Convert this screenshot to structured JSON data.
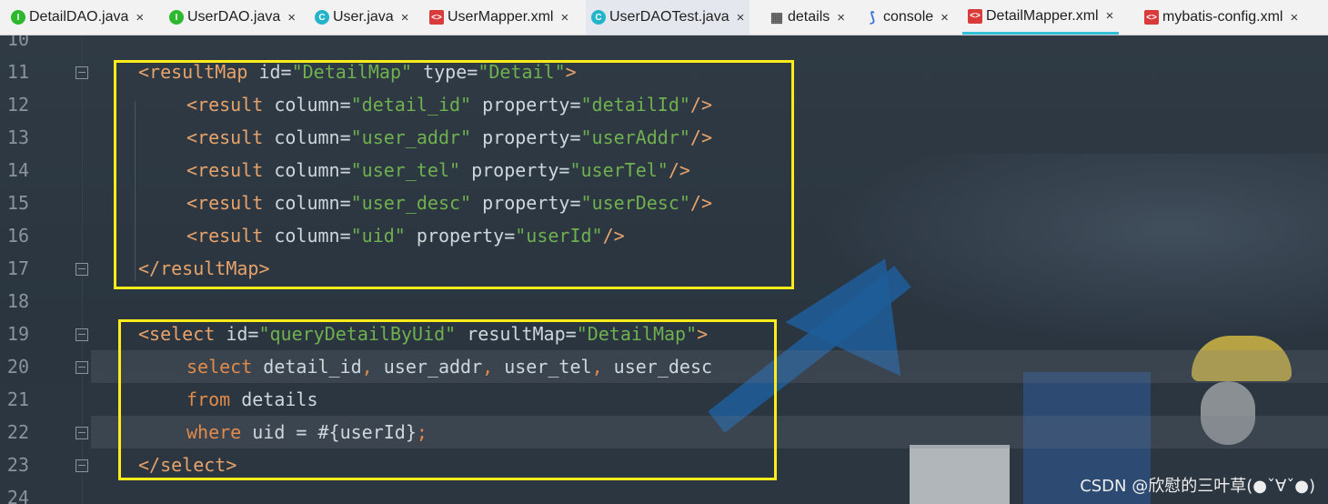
{
  "tabs": [
    {
      "label": "DetailDAO.java",
      "icon": "interface-icon",
      "icon_letter": "I",
      "icon_color": "#2eb82e",
      "active": false
    },
    {
      "label": "UserDAO.java",
      "icon": "interface-icon",
      "icon_letter": "I",
      "icon_color": "#2eb82e",
      "active": false
    },
    {
      "label": "User.java",
      "icon": "class-icon",
      "icon_letter": "C",
      "icon_color": "#22b5c9",
      "active": false
    },
    {
      "label": "UserMapper.xml",
      "icon": "xml-file-icon",
      "icon_letter": "<>",
      "icon_color": "#d93b3b",
      "active": false
    },
    {
      "label": "UserDAOTest.java",
      "icon": "test-class-icon",
      "icon_letter": "C",
      "icon_color": "#22b5c9",
      "active": true
    },
    {
      "label": "details",
      "icon": "table-icon",
      "icon_letter": "▦",
      "icon_color": "#555555",
      "active": false
    },
    {
      "label": "console",
      "icon": "console-icon",
      "icon_letter": "⟆",
      "icon_color": "#3b6fd9",
      "active": false
    },
    {
      "label": "DetailMapper.xml",
      "icon": "xml-file-icon",
      "icon_letter": "<>",
      "icon_color": "#d93b3b",
      "active": false,
      "selected": true
    },
    {
      "label": "mybatis-config.xml",
      "icon": "xml-file-icon",
      "icon_letter": "<>",
      "icon_color": "#d93b3b",
      "active": false
    }
  ],
  "close_glyph": "×",
  "lines": [
    {
      "num": "10",
      "tokens": []
    },
    {
      "num": "11",
      "tokens": [
        [
          "tag",
          "<resultMap "
        ],
        [
          "attr",
          "id"
        ],
        [
          "eq",
          "="
        ],
        [
          "str",
          "\"DetailMap\""
        ],
        [
          "attr",
          " type"
        ],
        [
          "eq",
          "="
        ],
        [
          "str",
          "\"Detail\""
        ],
        [
          "tag",
          ">"
        ]
      ]
    },
    {
      "num": "12",
      "tokens": [
        [
          "tag",
          "<result "
        ],
        [
          "attr",
          "column"
        ],
        [
          "eq",
          "="
        ],
        [
          "str",
          "\"detail_id\""
        ],
        [
          "attr",
          " property"
        ],
        [
          "eq",
          "="
        ],
        [
          "str",
          "\"detailId\""
        ],
        [
          "tag",
          "/>"
        ]
      ]
    },
    {
      "num": "13",
      "tokens": [
        [
          "tag",
          "<result "
        ],
        [
          "attr",
          "column"
        ],
        [
          "eq",
          "="
        ],
        [
          "str",
          "\"user_addr\""
        ],
        [
          "attr",
          " property"
        ],
        [
          "eq",
          "="
        ],
        [
          "str",
          "\"userAddr\""
        ],
        [
          "tag",
          "/>"
        ]
      ]
    },
    {
      "num": "14",
      "tokens": [
        [
          "tag",
          "<result "
        ],
        [
          "attr",
          "column"
        ],
        [
          "eq",
          "="
        ],
        [
          "str",
          "\"user_tel\""
        ],
        [
          "attr",
          " property"
        ],
        [
          "eq",
          "="
        ],
        [
          "str",
          "\"userTel\""
        ],
        [
          "tag",
          "/>"
        ]
      ]
    },
    {
      "num": "15",
      "tokens": [
        [
          "tag",
          "<result "
        ],
        [
          "attr",
          "column"
        ],
        [
          "eq",
          "="
        ],
        [
          "str",
          "\"user_desc\""
        ],
        [
          "attr",
          " property"
        ],
        [
          "eq",
          "="
        ],
        [
          "str",
          "\"userDesc\""
        ],
        [
          "tag",
          "/>"
        ]
      ]
    },
    {
      "num": "16",
      "tokens": [
        [
          "tag",
          "<result "
        ],
        [
          "attr",
          "column"
        ],
        [
          "eq",
          "="
        ],
        [
          "str",
          "\"uid\""
        ],
        [
          "attr",
          " property"
        ],
        [
          "eq",
          "="
        ],
        [
          "str",
          "\"userId\""
        ],
        [
          "tag",
          "/>"
        ]
      ]
    },
    {
      "num": "17",
      "tokens": [
        [
          "tag",
          "</resultMap>"
        ]
      ]
    },
    {
      "num": "18",
      "tokens": []
    },
    {
      "num": "19",
      "tokens": [
        [
          "tag",
          "<select "
        ],
        [
          "attr",
          "id"
        ],
        [
          "eq",
          "="
        ],
        [
          "str",
          "\"queryDetailByUid\""
        ],
        [
          "attr",
          " resultMap"
        ],
        [
          "eq",
          "="
        ],
        [
          "str",
          "\"DetailMap\""
        ],
        [
          "tag",
          ">"
        ]
      ]
    },
    {
      "num": "20",
      "tokens": [
        [
          "kw",
          "select"
        ],
        [
          "txt",
          " detail_id"
        ],
        [
          "punct",
          ","
        ],
        [
          "txt",
          " user_addr"
        ],
        [
          "punct",
          ","
        ],
        [
          "txt",
          " user_tel"
        ],
        [
          "punct",
          ","
        ],
        [
          "txt",
          " user_desc"
        ]
      ]
    },
    {
      "num": "21",
      "tokens": [
        [
          "kw",
          "from"
        ],
        [
          "txt",
          " details"
        ]
      ]
    },
    {
      "num": "22",
      "tokens": [
        [
          "kw",
          "where"
        ],
        [
          "txt",
          " uid = #{userId}"
        ],
        [
          "punct",
          ";"
        ]
      ]
    },
    {
      "num": "23",
      "tokens": [
        [
          "tag",
          "</select>"
        ]
      ]
    },
    {
      "num": "24",
      "tokens": []
    }
  ],
  "watermark": "CSDN @欣慰的三叶草(●ˇ∀ˇ●)"
}
